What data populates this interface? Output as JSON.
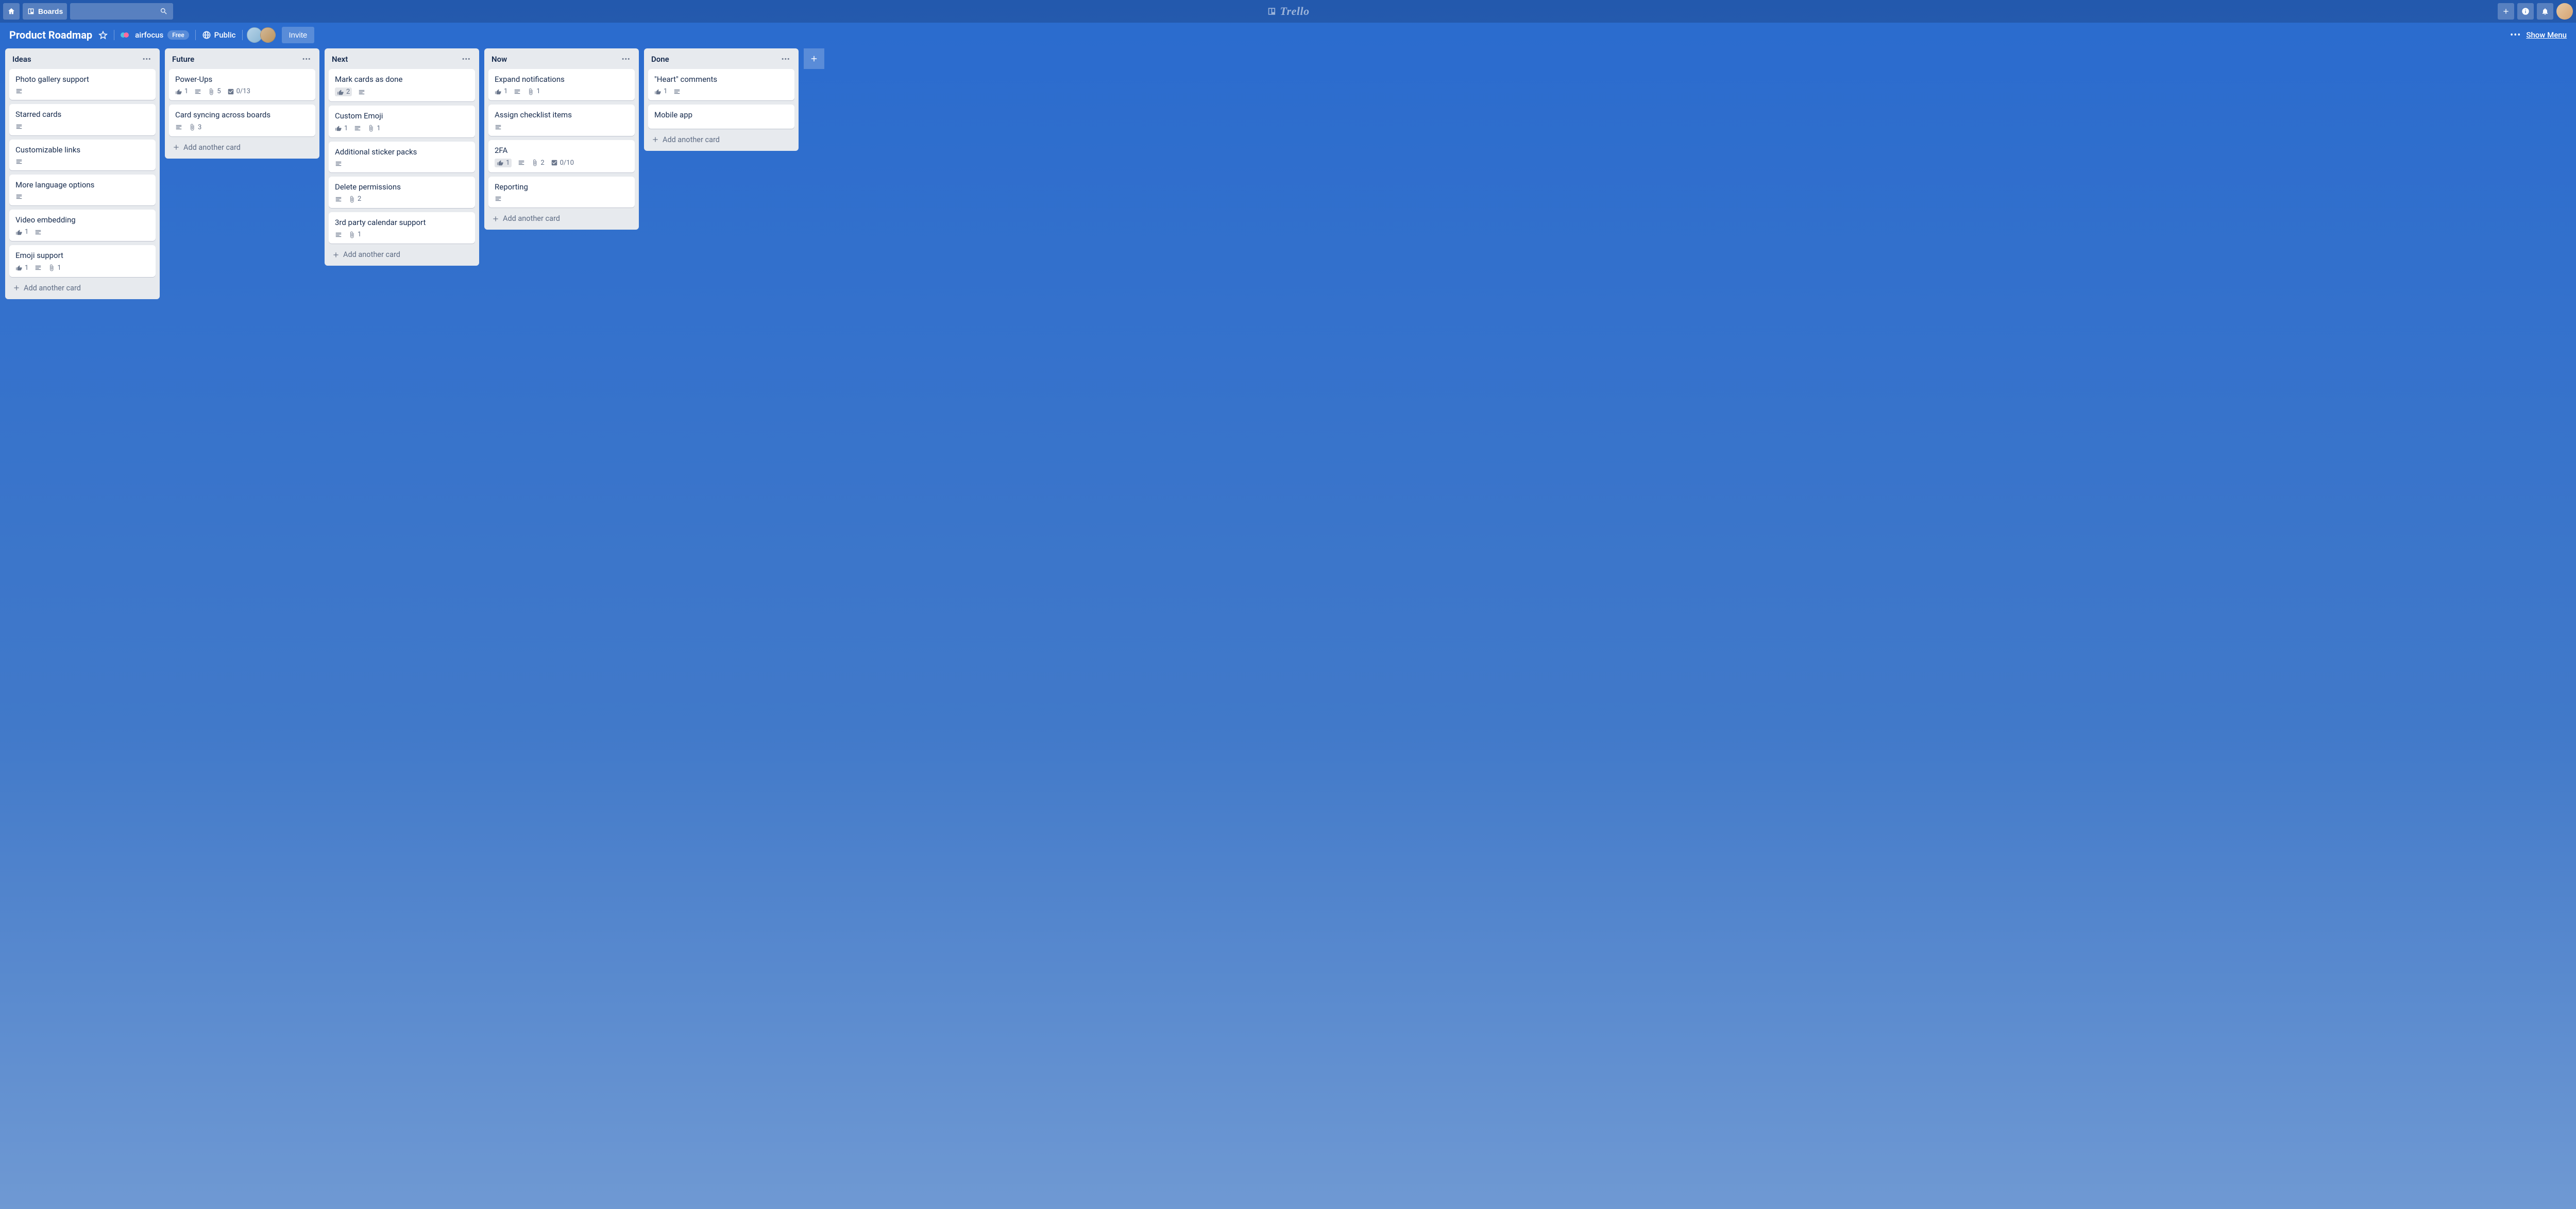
{
  "header": {
    "boards_label": "Boards",
    "logo_text": "Trello"
  },
  "board_bar": {
    "title": "Product Roadmap",
    "team_name": "airfocus",
    "plan_label": "Free",
    "visibility": "Public",
    "invite_label": "Invite",
    "show_menu_label": "Show Menu"
  },
  "add_card_label": "Add another card",
  "lists": [
    {
      "title": "Ideas",
      "cards": [
        {
          "title": "Photo gallery support",
          "desc": true
        },
        {
          "title": "Starred cards",
          "desc": true
        },
        {
          "title": "Customizable links",
          "desc": true
        },
        {
          "title": "More language options",
          "desc": true
        },
        {
          "title": "Video embedding",
          "votes": "1",
          "desc": true
        },
        {
          "title": "Emoji support",
          "votes": "1",
          "desc": true,
          "attach": "1"
        }
      ]
    },
    {
      "title": "Future",
      "cards": [
        {
          "title": "Power-Ups",
          "votes": "1",
          "desc": true,
          "attach": "5",
          "check": "0/13"
        },
        {
          "title": "Card syncing across boards",
          "desc": true,
          "attach": "3"
        }
      ]
    },
    {
      "title": "Next",
      "cards": [
        {
          "title": "Mark cards as done",
          "votes": "2",
          "voted": true,
          "desc": true
        },
        {
          "title": "Custom Emoji",
          "votes": "1",
          "desc": true,
          "attach": "1"
        },
        {
          "title": "Additional sticker packs",
          "desc": true
        },
        {
          "title": "Delete permissions",
          "desc": true,
          "attach": "2"
        },
        {
          "title": "3rd party calendar support",
          "desc": true,
          "attach": "1"
        }
      ]
    },
    {
      "title": "Now",
      "cards": [
        {
          "title": "Expand notifications",
          "votes": "1",
          "desc": true,
          "attach": "1"
        },
        {
          "title": "Assign checklist items",
          "desc": true
        },
        {
          "title": "2FA",
          "votes": "1",
          "voted": true,
          "desc": true,
          "attach": "2",
          "check": "0/10"
        },
        {
          "title": "Reporting",
          "desc": true
        }
      ]
    },
    {
      "title": "Done",
      "cards": [
        {
          "title": "\"Heart\" comments",
          "votes": "1",
          "desc": true
        },
        {
          "title": "Mobile app"
        }
      ]
    }
  ]
}
